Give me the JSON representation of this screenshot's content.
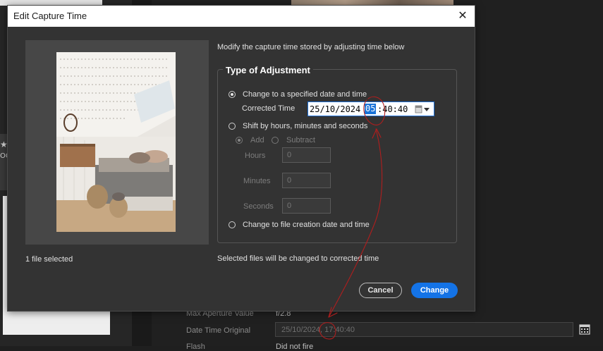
{
  "dialog": {
    "title": "Edit Capture Time",
    "close_glyph": "✕",
    "files_selected": "1 file selected",
    "instruction": "Modify the capture time stored by adjusting time below",
    "group_title": "Type of Adjustment",
    "option_specified": "Change to a specified date and time",
    "corrected_time_label": "Corrected Time",
    "corrected_date": "25/10/2024",
    "corrected_hour": "05",
    "corrected_rest": ":40:40",
    "option_shift": "Shift by hours, minutes and seconds",
    "add_label": "Add",
    "subtract_label": "Subtract",
    "hours_label": "Hours",
    "hours_value": "0",
    "minutes_label": "Minutes",
    "minutes_value": "0",
    "seconds_label": "Seconds",
    "seconds_value": "0",
    "option_file_creation": "Change to file creation date and time",
    "bottom_note": "Selected files will be changed to corrected time",
    "cancel_label": "Cancel",
    "change_label": "Change",
    "selected_option": "specified"
  },
  "background": {
    "star_glyph": "★",
    "oc_text": "OC",
    "max_aperture_label": "Max Aperture Value",
    "max_aperture_value": "f/2.8",
    "date_time_original_label": "Date Time Original",
    "date_time_original_value": "25/10/2024, 17:40:40",
    "flash_label": "Flash",
    "flash_value": "Did not fire"
  },
  "colors": {
    "accent": "#1473e6",
    "dialog_bg": "#333333",
    "annotation": "#b01e1e"
  },
  "icons": [
    "close-icon",
    "calendar-icon",
    "dropdown-arrow-icon",
    "star-icon"
  ]
}
